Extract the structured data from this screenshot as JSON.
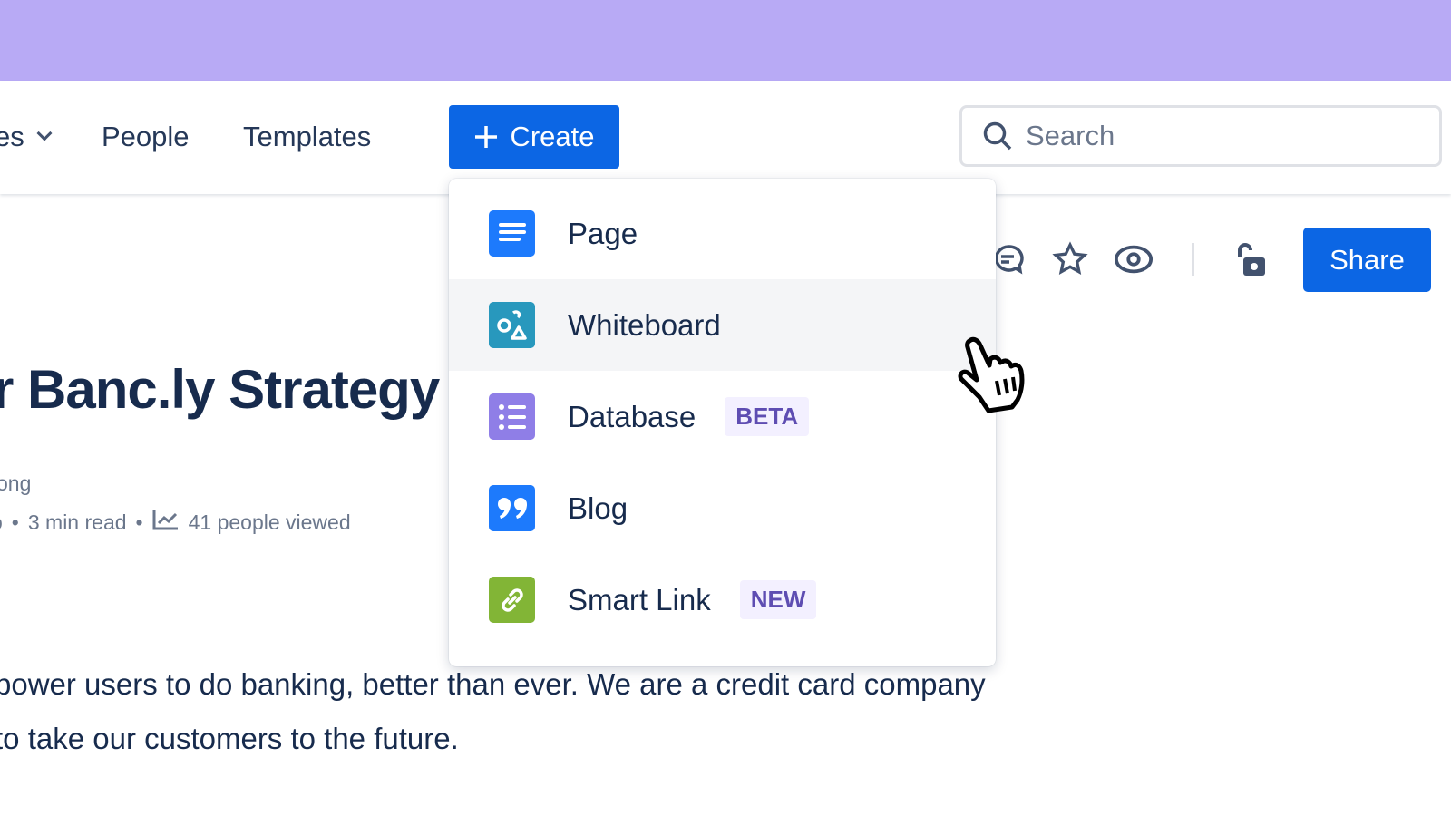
{
  "nav": {
    "spaces_partial": "es",
    "people": "People",
    "templates": "Templates",
    "create": "Create",
    "search_placeholder": "Search"
  },
  "menu": {
    "items": [
      {
        "label": "Page",
        "icon": "page-icon",
        "color": "#1d7afc"
      },
      {
        "label": "Whiteboard",
        "icon": "whiteboard-icon",
        "color": "#2898bd",
        "hovered": true
      },
      {
        "label": "Database",
        "icon": "database-icon",
        "color": "#8f7ee7",
        "badge": "BETA"
      },
      {
        "label": "Blog",
        "icon": "quote-icon",
        "color": "#1d7afc"
      },
      {
        "label": "Smart Link",
        "icon": "link-icon",
        "color": "#82b536",
        "badge": "NEW"
      }
    ]
  },
  "toolbar": {
    "share": "Share"
  },
  "page": {
    "title": "r Banc.ly Strategy",
    "byline": "ong",
    "meta_prefix": "o",
    "read_time": "3 min read",
    "views": "41 people viewed",
    "body_line1": "power users to do banking, better than ever. We are a credit card company",
    "body_line2": " to take our customers to the future."
  },
  "colors": {
    "banner": "#b8aaf5",
    "primary": "#0c66e4"
  }
}
